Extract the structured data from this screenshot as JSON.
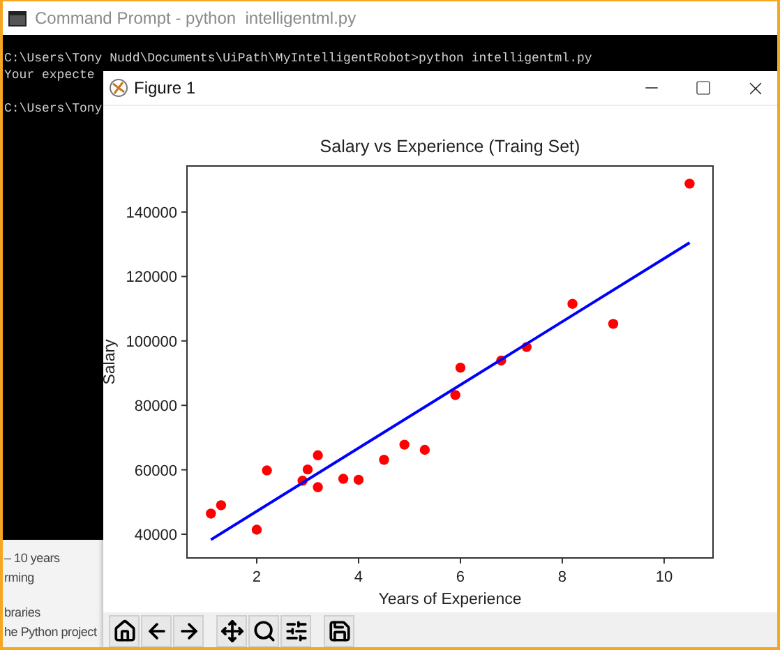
{
  "command_prompt": {
    "title": "Command Prompt - python  intelligentml.py",
    "blocks": [
      [
        "C:\\Users\\Tony Nudd\\Documents\\UiPath\\MyIntelligentRobot>python intelligentml.py",
        "Your expecte"
      ],
      [
        "C:\\Users\\Tony"
      ]
    ]
  },
  "document": {
    "paragraphs": [
      [
        "– 10 years",
        "rming"
      ],
      [
        "braries",
        "he Python project"
      ]
    ]
  },
  "figure_window": {
    "title": "Figure 1",
    "chart_data": {
      "type": "scatter",
      "title": "Salary vs Experience (Traing Set)",
      "xlabel": "Years of Experience",
      "ylabel": "Salary",
      "xlim": [
        0.63,
        10.96
      ],
      "ylim": [
        32640,
        154300
      ],
      "xticks": [
        2,
        4,
        6,
        8,
        10
      ],
      "yticks": [
        40000,
        60000,
        80000,
        100000,
        120000,
        140000
      ],
      "series": [
        {
          "type": "scatter",
          "color": "#ff0000",
          "x": [
            1.1,
            1.3,
            2.0,
            2.2,
            2.9,
            3.0,
            3.2,
            3.2,
            3.7,
            4.0,
            4.5,
            4.9,
            5.3,
            5.9,
            6.0,
            6.8,
            7.3,
            8.2,
            9.0,
            10.5
          ],
          "values": [
            46400,
            49000,
            41400,
            59800,
            56600,
            60100,
            64500,
            54600,
            57200,
            56900,
            63100,
            67800,
            66200,
            83200,
            91700,
            93900,
            98100,
            111500,
            105300,
            148800
          ]
        },
        {
          "type": "line",
          "color": "#0000ff",
          "x": [
            1.1,
            10.5
          ],
          "values": [
            38300,
            130500
          ]
        }
      ]
    },
    "toolbar": [
      {
        "buttons": [
          {
            "kind": "home"
          },
          {
            "kind": "back"
          },
          {
            "kind": "forward"
          }
        ]
      },
      {
        "buttons": [
          {
            "kind": "pan"
          },
          {
            "kind": "zoom"
          },
          {
            "kind": "configure"
          }
        ]
      },
      {
        "buttons": [
          {
            "kind": "save"
          }
        ]
      }
    ]
  }
}
